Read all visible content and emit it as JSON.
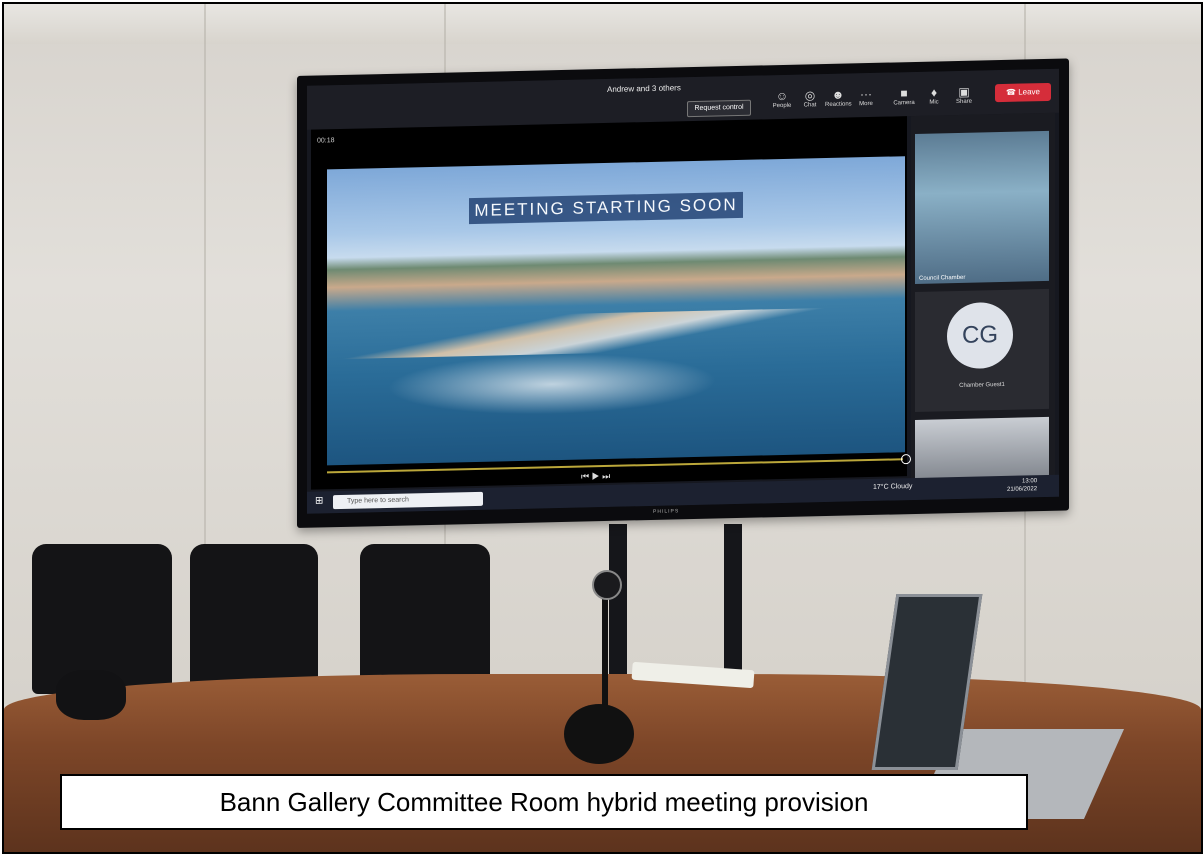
{
  "photo": {
    "caption": "Bann Gallery Committee Room hybrid meeting provision"
  },
  "tv": {
    "brand": "PHILIPS",
    "window_title": "Andrew and 3 others",
    "request_control": "Request control",
    "toolbar": [
      {
        "label": "People",
        "icon": "people-icon"
      },
      {
        "label": "Chat",
        "icon": "chat-icon"
      },
      {
        "label": "Reactions",
        "icon": "reactions-icon"
      },
      {
        "label": "More",
        "icon": "more-icon"
      },
      {
        "label": "Camera",
        "icon": "camera-icon"
      },
      {
        "label": "Mic",
        "icon": "mic-icon"
      },
      {
        "label": "Share",
        "icon": "share-icon"
      }
    ],
    "leave_label": "Leave",
    "timer": "00:18",
    "banner": "MEETING STARTING SOON",
    "tiles": {
      "room_label": "Council Chamber",
      "avatar_initials": "CG",
      "guest_label": "Chamber Guest1"
    },
    "taskbar": {
      "search_placeholder": "Type here to search",
      "weather": "17°C Cloudy",
      "time": "13:00",
      "date": "21/06/2022"
    }
  },
  "colors": {
    "leave_red": "#d52d3a",
    "banner_blue": "#2c4c7c",
    "table_wood": "#8a4f2d"
  }
}
